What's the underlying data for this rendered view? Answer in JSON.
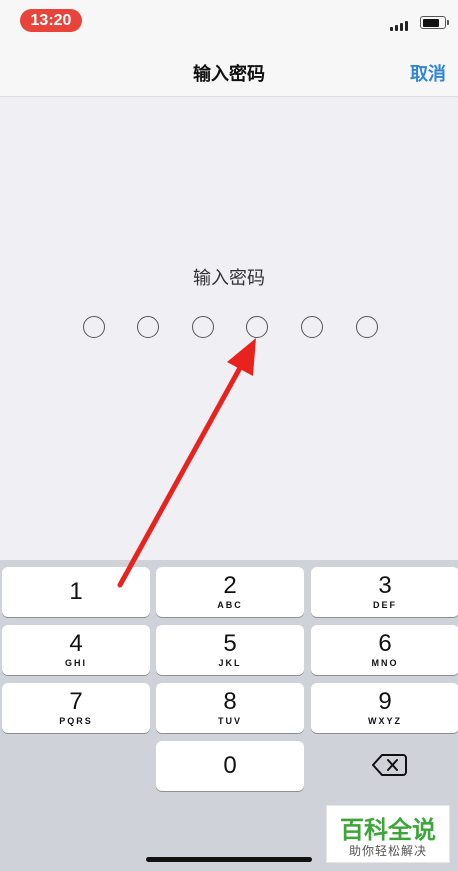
{
  "status_bar": {
    "time": "13:20"
  },
  "nav": {
    "title": "输入密码",
    "cancel_label": "取消"
  },
  "passcode": {
    "prompt": "输入密码",
    "digits_total": 6,
    "digits_entered": 0
  },
  "keypad": {
    "keys": [
      {
        "number": "1",
        "letters": ""
      },
      {
        "number": "2",
        "letters": "ABC"
      },
      {
        "number": "3",
        "letters": "DEF"
      },
      {
        "number": "4",
        "letters": "GHI"
      },
      {
        "number": "5",
        "letters": "JKL"
      },
      {
        "number": "6",
        "letters": "MNO"
      },
      {
        "number": "7",
        "letters": "PQRS"
      },
      {
        "number": "8",
        "letters": "TUV"
      },
      {
        "number": "9",
        "letters": "WXYZ"
      },
      {
        "number": "0",
        "letters": ""
      }
    ]
  },
  "watermark": {
    "main": "百科全说",
    "sub": "助你轻松解决"
  },
  "colors": {
    "accent": "#2f86d8",
    "arrow": "#e8231f",
    "time_pill": "#e8443a",
    "watermark_green": "#3da638"
  }
}
